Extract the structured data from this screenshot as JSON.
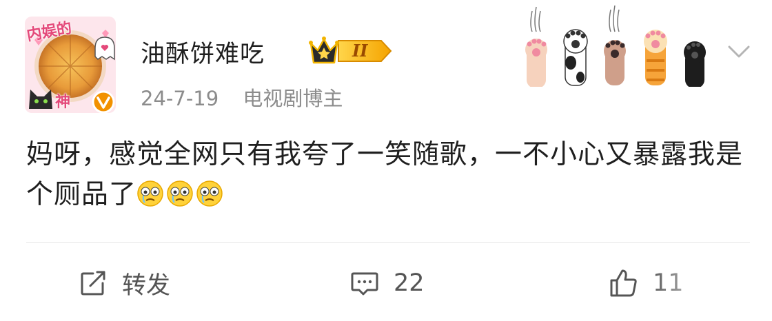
{
  "post": {
    "avatar": {
      "caption_top": "内娱的",
      "caption_bottom": "神",
      "icon": "pizza-avatar-with-verified-badge"
    },
    "username": "油酥饼难吃",
    "level_badge": {
      "label": "II",
      "icon": "crown-icon",
      "color": "#f5b400"
    },
    "date": "24-7-19",
    "role": "电视剧博主",
    "decoration_icon": "cat-paws-icon",
    "content_text": "妈呀，感觉全网只有我夸了一笑随歌，一不小心又暴露我是个厕品了",
    "emojis": [
      "crying-face-emoji",
      "crying-face-emoji",
      "crying-face-emoji"
    ],
    "actions": {
      "repost": {
        "label": "转发",
        "icon": "repost-icon"
      },
      "comment": {
        "count": "22",
        "icon": "comment-icon"
      },
      "like": {
        "count": "11",
        "icon": "thumbs-up-icon"
      }
    },
    "colors": {
      "accent_pink": "#e4497a",
      "verified_orange": "#f29100",
      "meta_gray": "#8c8c8c"
    }
  }
}
